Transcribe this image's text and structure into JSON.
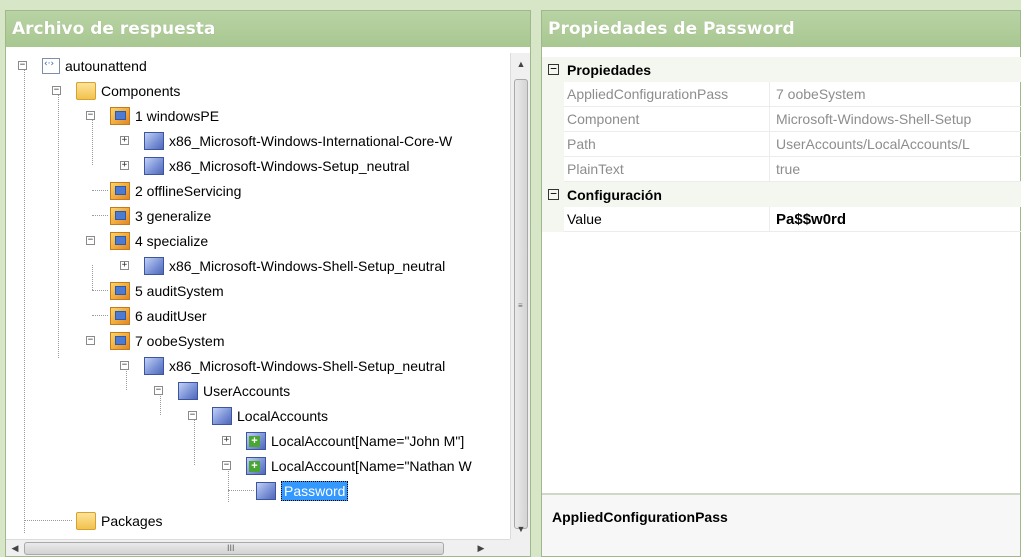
{
  "left_pane": {
    "title": "Archivo de respuesta",
    "tree": [
      {
        "label": "autounattend",
        "icon": "xml-file-icon",
        "expander": "−"
      },
      {
        "label": "Components",
        "icon": "folder-icon",
        "expander": "−"
      },
      {
        "label": "1 windowsPE",
        "icon": "configuration-pass-icon",
        "expander": "−"
      },
      {
        "label": "x86_Microsoft-Windows-International-Core-W",
        "icon": "component-icon",
        "expander": "+"
      },
      {
        "label": "x86_Microsoft-Windows-Setup_neutral",
        "icon": "component-icon",
        "expander": "+"
      },
      {
        "label": "2 offlineServicing",
        "icon": "configuration-pass-icon",
        "expander": ""
      },
      {
        "label": "3 generalize",
        "icon": "configuration-pass-icon",
        "expander": ""
      },
      {
        "label": "4 specialize",
        "icon": "configuration-pass-icon",
        "expander": "−"
      },
      {
        "label": "x86_Microsoft-Windows-Shell-Setup_neutral",
        "icon": "component-icon",
        "expander": "+"
      },
      {
        "label": "5 auditSystem",
        "icon": "configuration-pass-icon",
        "expander": ""
      },
      {
        "label": "6 auditUser",
        "icon": "configuration-pass-icon",
        "expander": ""
      },
      {
        "label": "7 oobeSystem",
        "icon": "configuration-pass-icon",
        "expander": "−"
      },
      {
        "label": "x86_Microsoft-Windows-Shell-Setup_neutral",
        "icon": "component-icon",
        "expander": "−"
      },
      {
        "label": "UserAccounts",
        "icon": "component-icon",
        "expander": "−"
      },
      {
        "label": "LocalAccounts",
        "icon": "component-icon",
        "expander": "−"
      },
      {
        "label": "LocalAccount[Name=\"John M\"]",
        "icon": "list-item-icon",
        "expander": "+"
      },
      {
        "label": "LocalAccount[Name=\"Nathan W",
        "icon": "list-item-icon",
        "expander": "−"
      },
      {
        "label": "Password",
        "icon": "component-icon",
        "expander": "",
        "selected": true
      },
      {
        "label": "Packages",
        "icon": "folder-icon",
        "expander": ""
      }
    ],
    "hscroll_grip": "III",
    "vscroll_grip": "≡"
  },
  "right_pane": {
    "title": "Propiedades de Password",
    "categories": [
      {
        "label": "Propiedades",
        "expander": "−",
        "rows": [
          {
            "key": "AppliedConfigurationPass",
            "value": "7 oobeSystem"
          },
          {
            "key": "Component",
            "value": "Microsoft-Windows-Shell-Setup"
          },
          {
            "key": "Path",
            "value": "UserAccounts/LocalAccounts/L"
          },
          {
            "key": "PlainText",
            "value": "true"
          }
        ]
      },
      {
        "label": "Configuración",
        "expander": "−",
        "rows": [
          {
            "key": "Value",
            "value": "Pa$$w0rd"
          }
        ]
      }
    ],
    "description_title": "AppliedConfigurationPass"
  }
}
